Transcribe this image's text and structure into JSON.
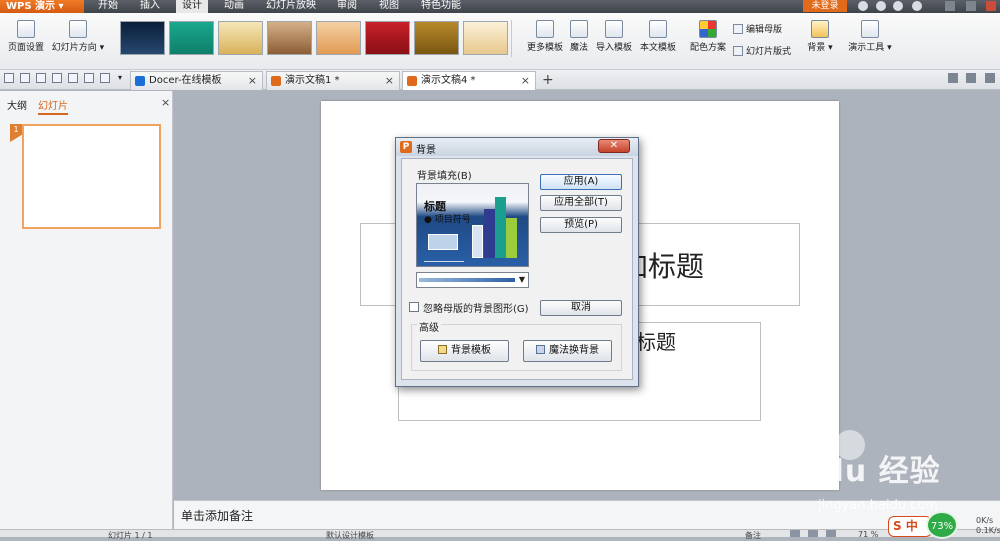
{
  "app": {
    "name": "WPS 演示"
  },
  "menu": [
    "开始",
    "插入",
    "设计",
    "动画",
    "幻灯片放映",
    "审阅",
    "视图",
    "特色功能"
  ],
  "menu_active": "设计",
  "login": "未登录",
  "ribbon": {
    "page_setup": "页面设置",
    "slide_direction": "幻灯片方向",
    "more_templates": "更多模板",
    "magic": "魔法",
    "import_template": "导入模板",
    "this_template": "本文模板",
    "color_scheme": "配色方案",
    "edit_master": "编辑母版",
    "slide_layout": "幻灯片版式",
    "background": "背景",
    "presentation_tools": "演示工具"
  },
  "tabs": [
    {
      "label": "Docer-在线模板"
    },
    {
      "label": "演示文稿1 *"
    },
    {
      "label": "演示文稿4 *"
    }
  ],
  "left_panel": {
    "outline_tab": "大纲",
    "slides_tab": "幻灯片",
    "slide_number": "1"
  },
  "slide": {
    "title_text": "加标题",
    "subtitle_text": "标题"
  },
  "notes": "单击添加备注",
  "status": {
    "slide_info": "幻灯片 1 / 1",
    "template": "默认设计模板",
    "zoom": "71 %",
    "notes_label": "备注"
  },
  "dialog": {
    "title": "背景",
    "fill_label": "背景填充(B)",
    "preview_title": "标题",
    "preview_bullet": "● 项目符号",
    "apply": "应用(A)",
    "apply_all": "应用全部(T)",
    "preview": "预览(P)",
    "ignore_master": "忽略母版的背景图形(G)",
    "cancel": "取消",
    "advanced": "高级",
    "bg_template": "背景模板",
    "magic_bg": "魔法换背景"
  },
  "chart_preview": {
    "bar_colors": [
      "#d9e4f2",
      "#2f3c8f",
      "#1a9f8e",
      "#9bcc3c"
    ]
  },
  "watermark": {
    "logo": "Baidu 经验",
    "url": "jingyan.baidu.com"
  },
  "tray": {
    "ime": "中",
    "cpu": "73%",
    "net_up": "0K/s",
    "net_down": "0.1K/s"
  }
}
